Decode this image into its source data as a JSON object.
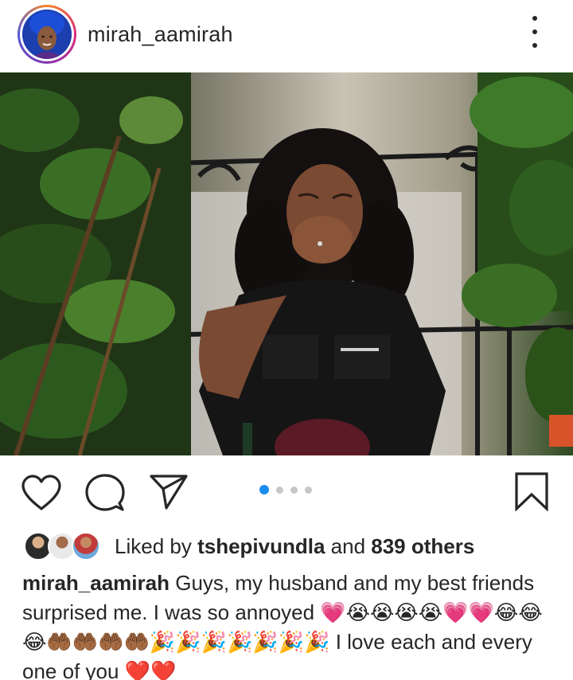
{
  "post": {
    "username": "mirah_aamirah",
    "more_icon": "more-vertical-icon",
    "avatar_icon": "profile-avatar",
    "photo_icon": "post-photo",
    "carousel": {
      "total": 4,
      "active": 1
    }
  },
  "actions": {
    "like_icon": "heart-icon",
    "comment_icon": "comment-icon",
    "share_icon": "paper-plane-icon",
    "save_icon": "bookmark-icon"
  },
  "likes": {
    "prefix": "Liked by ",
    "user": "tshepivundla",
    "connector": " and ",
    "others": "839 others"
  },
  "caption": {
    "username": "mirah_aamirah",
    "text": "Guys, my husband and my best friends surprised me. I was so annoyed 💗😭😭😭😭💗💗😂😂😂🤲🏾🤲🏾🤲🏾🤲🏾🎉🎉🎉🎉🎉🎉🎉 I love each and every one of you ❤️❤️"
  },
  "colors": {
    "text": "#262626",
    "carousel_active": "#1a8cf0",
    "carousel_inactive": "#c7c7c7"
  }
}
